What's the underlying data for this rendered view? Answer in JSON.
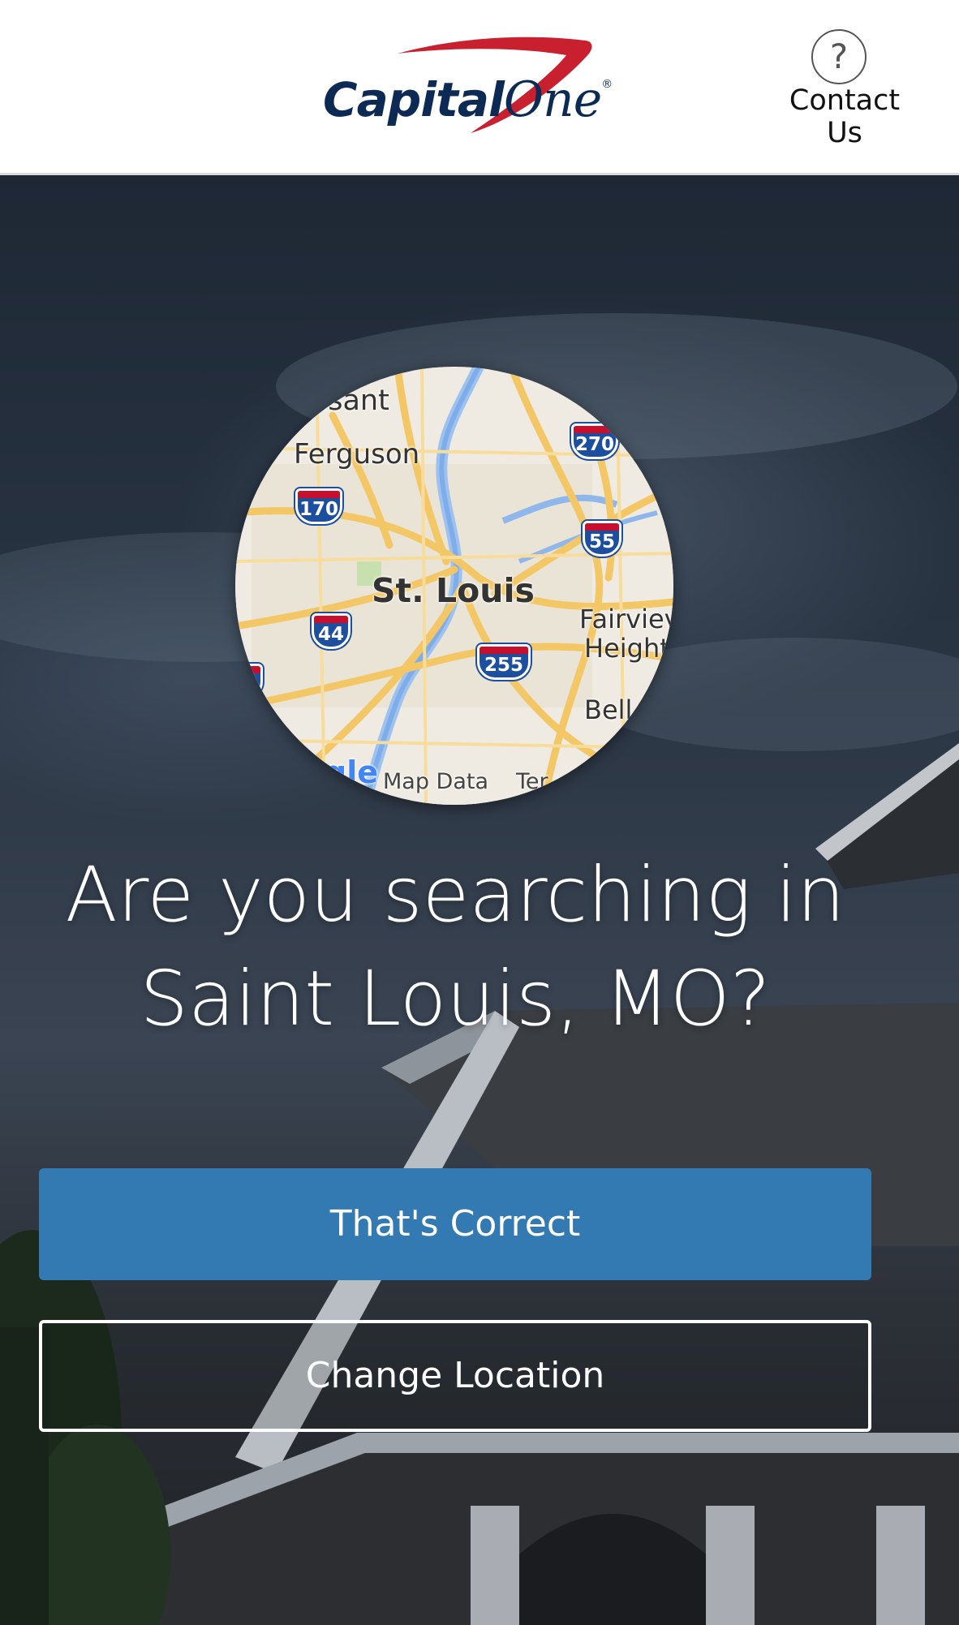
{
  "header": {
    "logo": {
      "capital": "Capital",
      "one": "One",
      "registered": "®"
    },
    "contact": {
      "icon": "?",
      "label": "Contact Us"
    }
  },
  "map": {
    "labels": {
      "place_north": "ssant",
      "ferguson": "Ferguson",
      "city": "St. Louis",
      "fairview_1": "Fairviev",
      "fairview_2": "Height",
      "belleville": "Bell",
      "google": "gle",
      "map_data": "Map Data",
      "terms": "Ter"
    },
    "shields": {
      "i270": "270",
      "i170": "170",
      "i55": "55",
      "i44": "44",
      "i255": "255",
      "i70": "0"
    }
  },
  "question": {
    "line1": "Are you searching in",
    "line2": "Saint Louis, MO?"
  },
  "actions": {
    "confirm": "That's Correct",
    "change": "Change Location"
  },
  "colors": {
    "primary_button": "#347ab2",
    "brand_navy": "#0d2a55",
    "brand_red": "#c8202f"
  }
}
